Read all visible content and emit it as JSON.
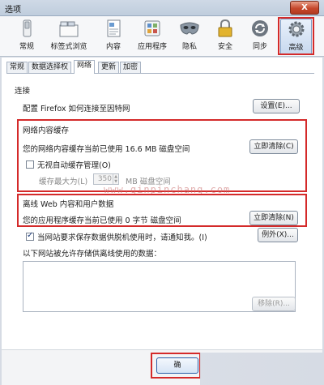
{
  "window": {
    "title": "选项",
    "close_label": "X"
  },
  "toolbar": {
    "items": [
      {
        "label": "常规",
        "icon": "switch-icon"
      },
      {
        "label": "标签式浏览",
        "icon": "tabs-icon"
      },
      {
        "label": "内容",
        "icon": "page-icon"
      },
      {
        "label": "应用程序",
        "icon": "applications-icon"
      },
      {
        "label": "隐私",
        "icon": "mask-icon"
      },
      {
        "label": "安全",
        "icon": "lock-icon"
      },
      {
        "label": "同步",
        "icon": "sync-icon"
      },
      {
        "label": "高级",
        "icon": "gear-icon"
      }
    ],
    "active": "高级"
  },
  "subtabs": {
    "items": [
      "常规",
      "数据选择权",
      "网络",
      "更新",
      "加密"
    ],
    "active": "网络"
  },
  "connection": {
    "title": "连接",
    "description": "配置 Firefox 如何连接至因特网",
    "settings_button": "设置(E)..."
  },
  "cache": {
    "title": "网络内容缓存",
    "usage_text": "您的网络内容缓存当前已使用 16.6 MB 磁盘空间",
    "clear_button": "立即清除(C)",
    "override_label": "无视自动缓存管理(O)",
    "override_checked": false,
    "limit_label": "缓存最大为(L)",
    "limit_value": "350",
    "limit_unit": "MB 磁盘空间"
  },
  "offline": {
    "title": "离线 Web 内容和用户数据",
    "usage_text": "您的应用程序缓存当前已使用 0 字节 磁盘空间",
    "clear_button": "立即清除(N)",
    "notify_label": "当网站要求保存数据供脱机使用时，请通知我。(I)",
    "notify_checked": true,
    "exceptions_button": "例外(X)...",
    "allowed_label": "以下网站被允许存储供离线使用的数据：",
    "remove_button": "移除(R)..."
  },
  "watermark": "www.qinpinchang.com",
  "footer": {
    "ok_button": "确"
  },
  "colors": {
    "highlight": "#d42a2a",
    "accent": "#2b5ea8"
  }
}
